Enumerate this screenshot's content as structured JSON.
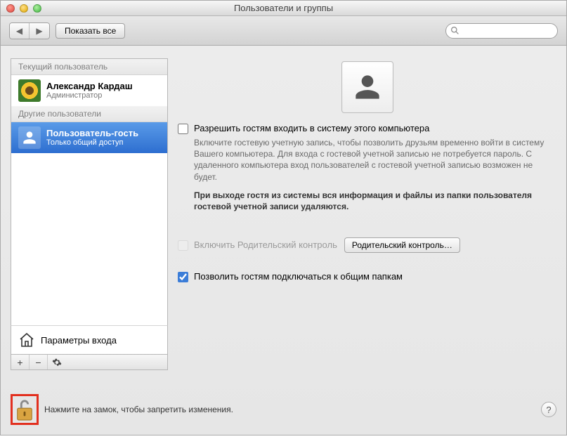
{
  "window": {
    "title": "Пользователи и группы"
  },
  "toolbar": {
    "show_all": "Показать все",
    "search_placeholder": ""
  },
  "sidebar": {
    "section_current": "Текущий пользователь",
    "section_other": "Другие пользователи",
    "current_user": {
      "name": "Александр Кардаш",
      "role": "Администратор"
    },
    "guest_user": {
      "name": "Пользователь-гость",
      "role": "Только общий доступ"
    },
    "login_options": "Параметры входа"
  },
  "main": {
    "allow_guest_login_label": "Разрешить гостям входить в систему этого компьютера",
    "allow_guest_login_checked": false,
    "guest_hint": "Включите гостевую учетную запись, чтобы позволить друзьям временно войти в систему Вашего компьютера. Для входа с гостевой учетной записью не потребуется пароль. С удаленного компьютера вход пользователей с гостевой учетной записью возможен не будет.",
    "guest_logout_hint": "При выходе гостя из системы вся информация и файлы из папки пользователя гостевой учетной записи удаляются.",
    "parental_enable_label": "Включить Родительский контроль",
    "parental_enable_checked": false,
    "parental_button": "Родительский контроль…",
    "allow_shared_label": "Позволить гостям подключаться к общим папкам",
    "allow_shared_checked": true
  },
  "lock": {
    "text": "Нажмите на замок, чтобы запретить изменения."
  }
}
